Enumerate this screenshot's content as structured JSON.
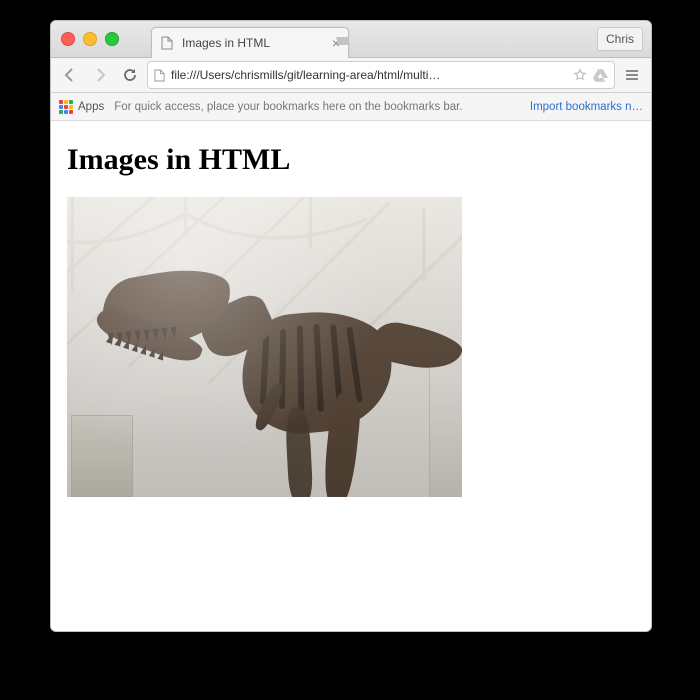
{
  "window": {
    "profile_label": "Chris"
  },
  "tab": {
    "title": "Images in HTML"
  },
  "toolbar": {
    "url": "file:///Users/chrismills/git/learning-area/html/multi…"
  },
  "bookmarks_bar": {
    "apps_label": "Apps",
    "hint": "For quick access, place your bookmarks here on the bookmarks bar.",
    "import_link": "Import bookmarks n…"
  },
  "page": {
    "heading": "Images in HTML",
    "image_alt": "A T-Rex skeleton on display in a museum hall"
  },
  "colors": {
    "apps_grid": [
      "#ea4335",
      "#fbbc05",
      "#34a853",
      "#4285f4",
      "#ea4335",
      "#fbbc05",
      "#34a853",
      "#4285f4",
      "#ea4335"
    ]
  }
}
